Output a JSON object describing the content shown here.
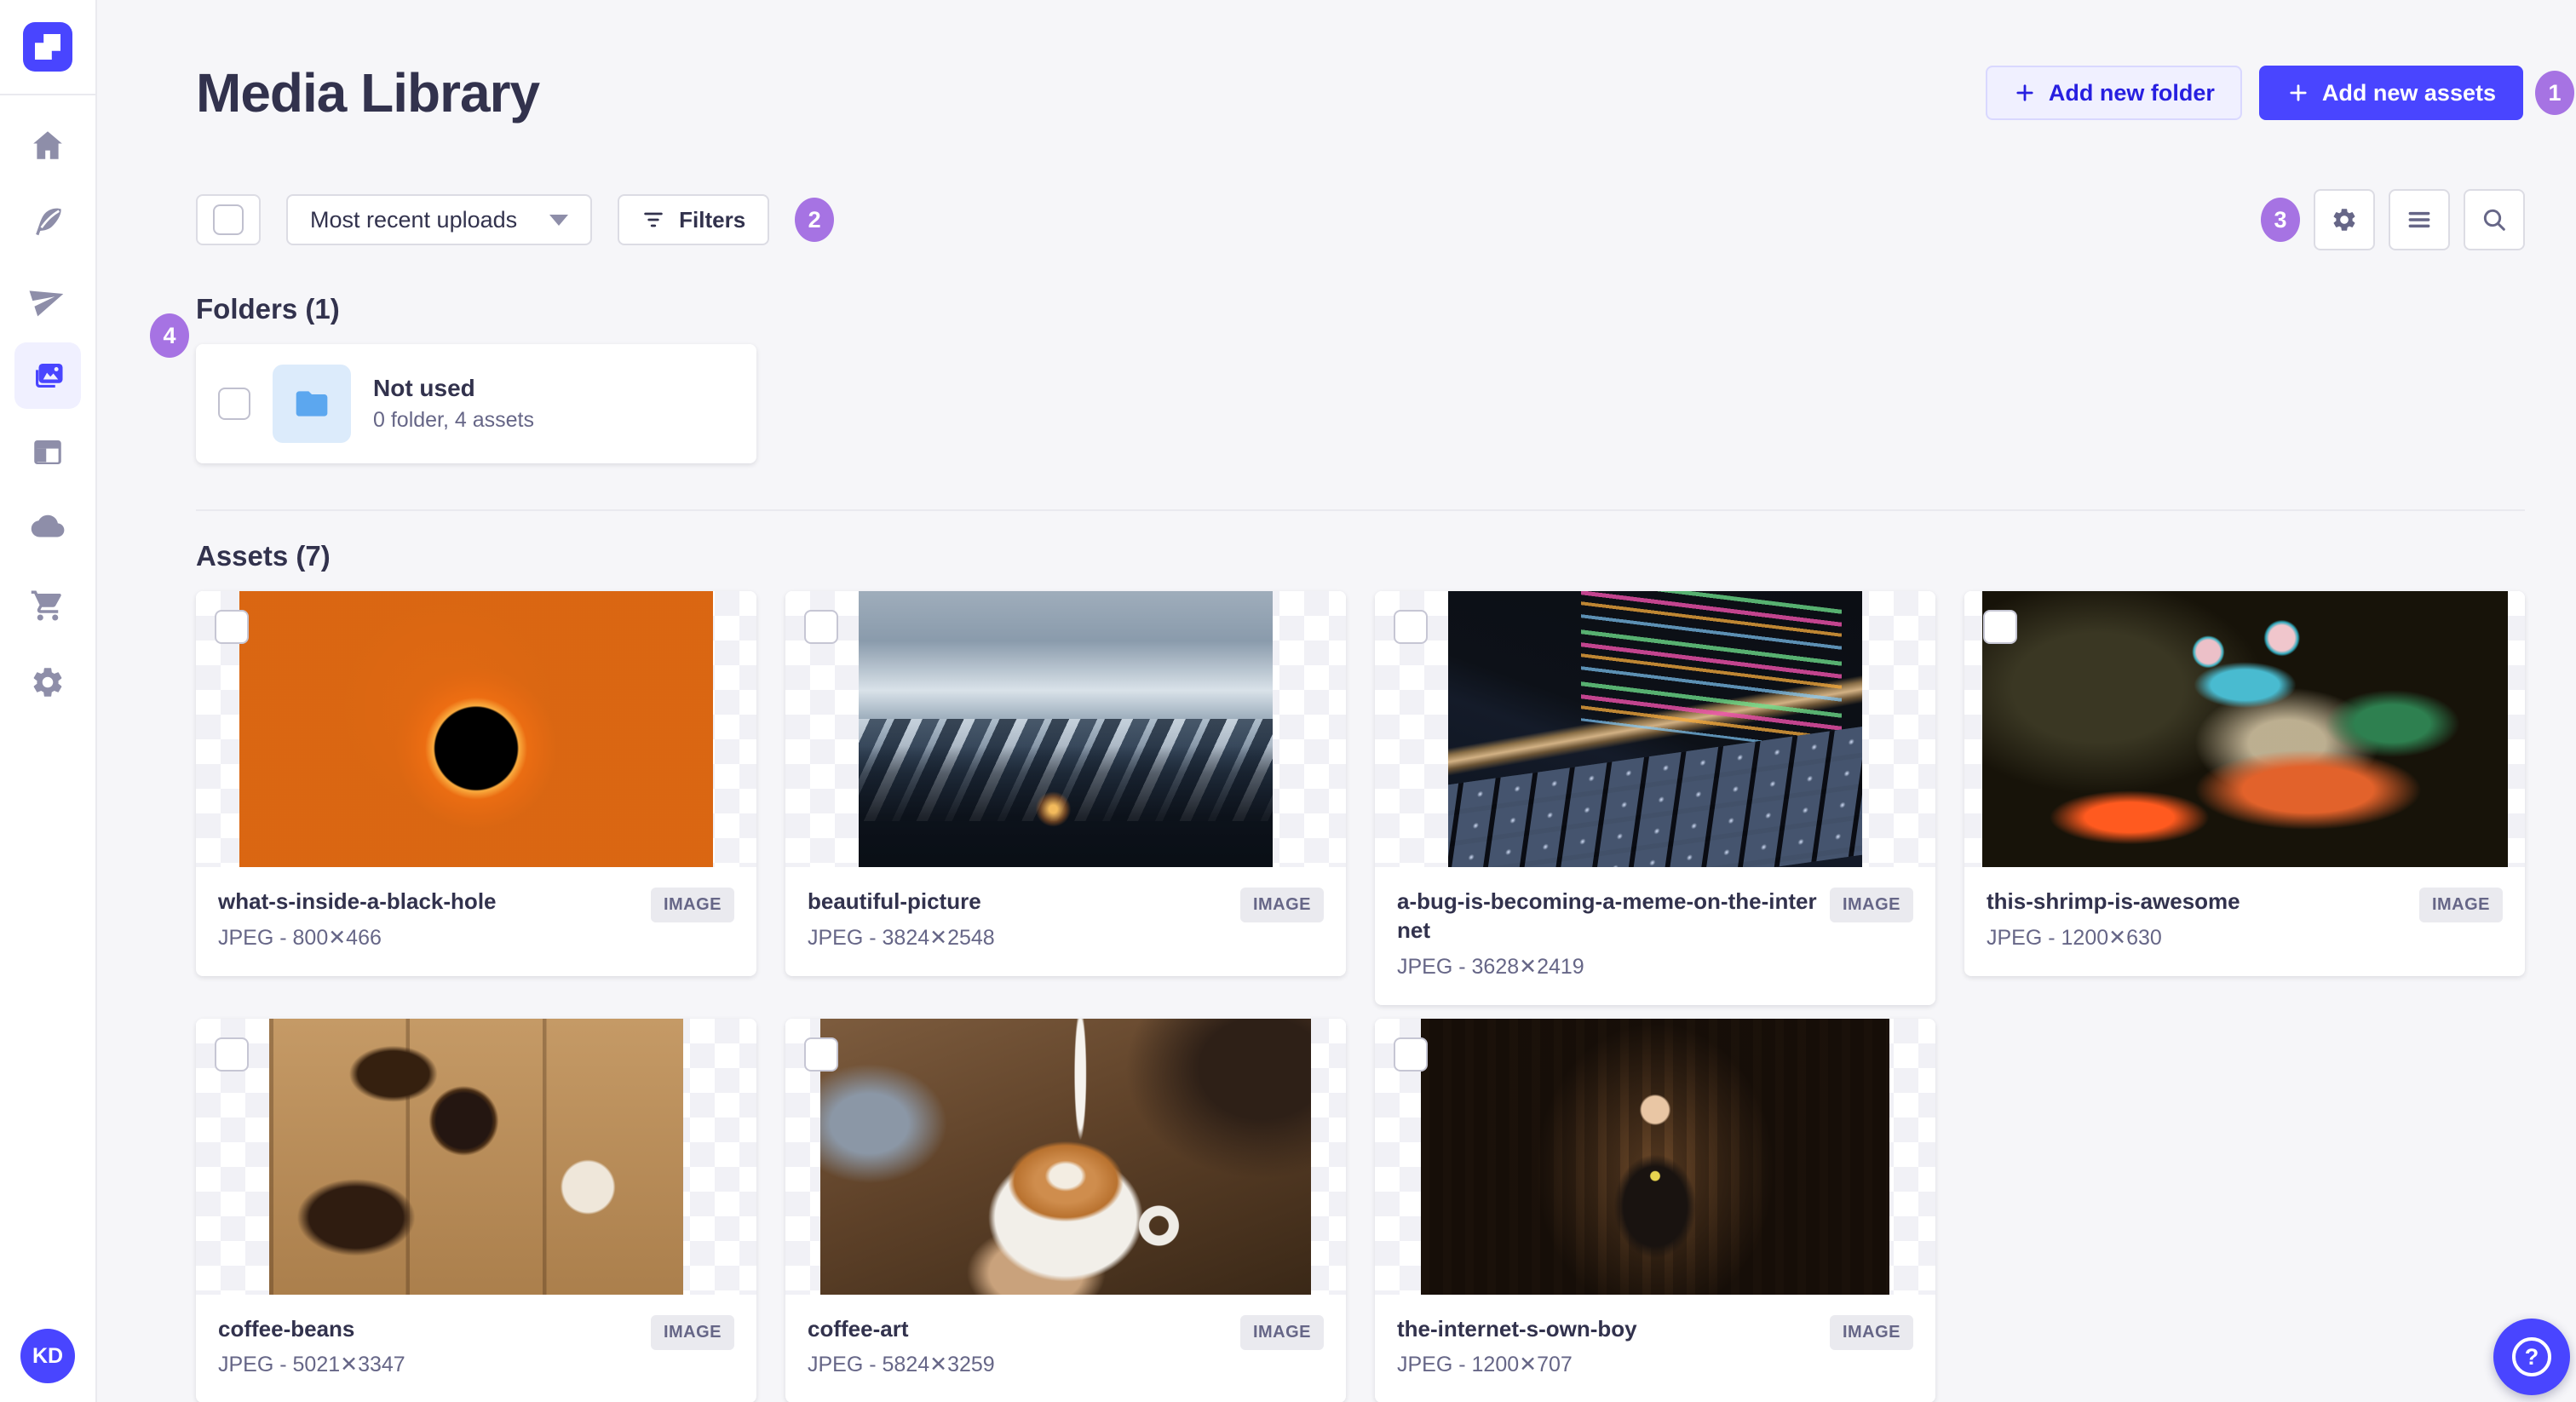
{
  "page": {
    "title": "Media Library"
  },
  "header": {
    "add_folder_label": "Add new folder",
    "add_assets_label": "Add new assets"
  },
  "toolbar": {
    "sort_value": "Most recent uploads",
    "filters_label": "Filters",
    "icons": [
      "settings-icon",
      "list-icon",
      "search-icon"
    ]
  },
  "annotations": {
    "n1": "1",
    "n2": "2",
    "n3": "3",
    "n4": "4"
  },
  "sidebar": {
    "icons": [
      "home-icon",
      "feather-icon",
      "paper-plane-icon",
      "media-library-icon",
      "layout-icon",
      "cloud-icon",
      "cart-icon",
      "settings-icon"
    ],
    "selected": "media-library-icon"
  },
  "user": {
    "initials": "KD"
  },
  "help": {
    "label": "?"
  },
  "folders": {
    "heading": "Folders (1)",
    "items": [
      {
        "name": "Not used",
        "meta": "0 folder, 4 assets"
      }
    ]
  },
  "assets": {
    "heading": "Assets (7)",
    "type_badge": "IMAGE",
    "items": [
      {
        "name": "what-s-inside-a-black-hole",
        "meta": "JPEG - 800✕466"
      },
      {
        "name": "beautiful-picture",
        "meta": "JPEG - 3824✕2548"
      },
      {
        "name": "a-bug-is-becoming-a-meme-on-the-internet",
        "meta": "JPEG - 3628✕2419"
      },
      {
        "name": "this-shrimp-is-awesome",
        "meta": "JPEG - 1200✕630"
      },
      {
        "name": "coffee-beans",
        "meta": "JPEG - 5021✕3347"
      },
      {
        "name": "coffee-art",
        "meta": "JPEG - 5824✕3259"
      },
      {
        "name": "the-internet-s-own-boy",
        "meta": "JPEG - 1200✕707"
      }
    ]
  },
  "colors": {
    "primary": "#4945FF",
    "annotation": "#A673E3",
    "folder_icon": "#5CA7EF"
  }
}
